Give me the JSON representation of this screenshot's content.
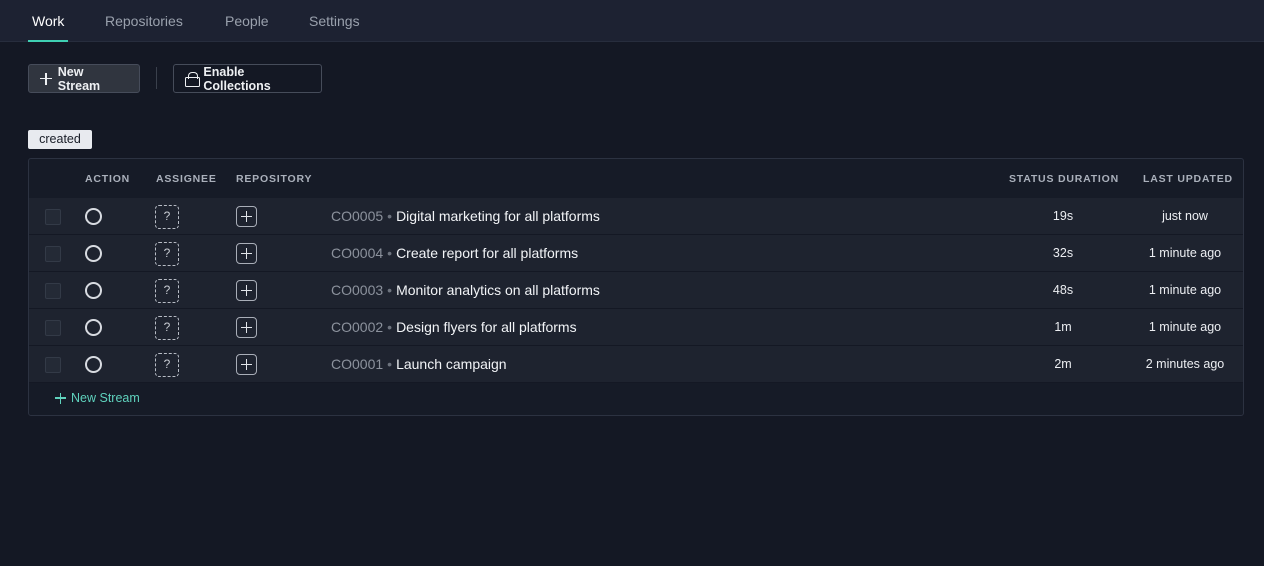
{
  "tabs": [
    {
      "label": "Work",
      "active": true
    },
    {
      "label": "Repositories",
      "active": false
    },
    {
      "label": "People",
      "active": false
    },
    {
      "label": "Settings",
      "active": false
    }
  ],
  "toolbar": {
    "new_stream_label": "New Stream",
    "enable_collections_label": "Enable Collections"
  },
  "group_badge": "created",
  "table": {
    "columns": {
      "action": "ACTION",
      "assignee": "ASSIGNEE",
      "repository": "REPOSITORY",
      "status_duration": "STATUS DURATION",
      "last_updated": "LAST UPDATED"
    },
    "rows": [
      {
        "code": "CO0005",
        "name": "Digital marketing for all platforms",
        "duration": "19s",
        "updated": "just now",
        "assignee": "?"
      },
      {
        "code": "CO0004",
        "name": "Create report for all platforms",
        "duration": "32s",
        "updated": "1 minute ago",
        "assignee": "?"
      },
      {
        "code": "CO0003",
        "name": "Monitor analytics on all platforms",
        "duration": "48s",
        "updated": "1 minute ago",
        "assignee": "?"
      },
      {
        "code": "CO0002",
        "name": "Design flyers for all platforms",
        "duration": "1m",
        "updated": "1 minute ago",
        "assignee": "?"
      },
      {
        "code": "CO0001",
        "name": "Launch campaign",
        "duration": "2m",
        "updated": "2 minutes ago",
        "assignee": "?"
      }
    ],
    "separator": "•",
    "footer_link": "New Stream"
  },
  "colors": {
    "accent": "#3fd0b3",
    "background": "#141824",
    "topbar": "#1d2232",
    "row": "#1e232f"
  }
}
